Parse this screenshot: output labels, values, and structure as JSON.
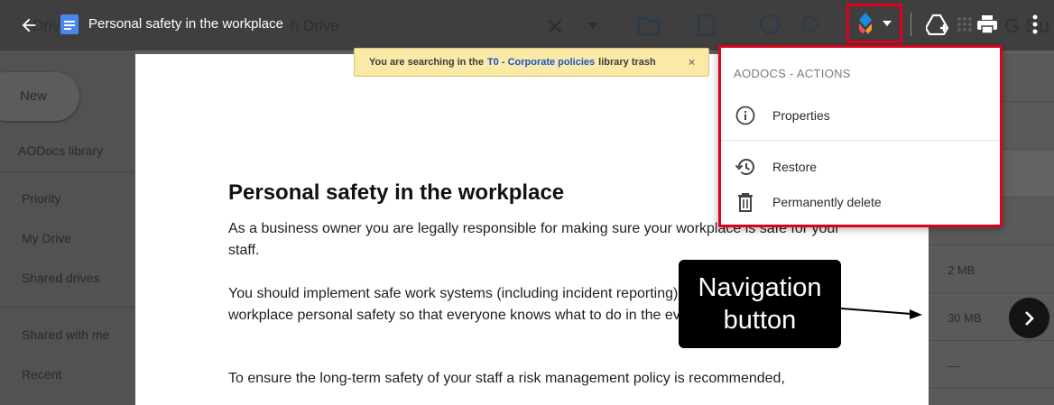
{
  "window": {
    "title": "Personal safety in the workplace"
  },
  "background": {
    "ghost_search_text": "h Drive",
    "ghost_brand_text": "G Su",
    "ghost_drive_text": "Drive",
    "new_button": "New",
    "sidebar": {
      "library": "AODocs library",
      "items": [
        "Priority",
        "My Drive",
        "Shared drives",
        "Shared with me",
        "Recent"
      ]
    },
    "file_sizes": [
      "2 MB",
      "30 MB",
      "—"
    ]
  },
  "banner": {
    "prefix": "You are searching in the",
    "library_link": "T0 - Corporate policies",
    "suffix": "library trash",
    "close": "×"
  },
  "document": {
    "heading": "Personal safety in the workplace",
    "paragraphs": [
      "As a business owner you are legally responsible for making sure your workplace is safe for your staff.",
      "You should implement safe work systems (including incident reporting) and train your staff in workplace personal safety so that everyone knows what to do in the event of an accident.",
      "To ensure the long-term safety of your staff a risk management policy is recommended,"
    ]
  },
  "menu": {
    "header": "AODOCS - ACTIONS",
    "items": [
      {
        "label": "Properties",
        "icon": "info-icon"
      },
      {
        "label": "Restore",
        "icon": "restore-icon"
      },
      {
        "label": "Permanently delete",
        "icon": "trash-icon"
      }
    ]
  },
  "callout": {
    "line1": "Navigation",
    "line2": "button"
  },
  "colors": {
    "highlight_red": "#e0001b",
    "banner_bg": "#fbe9a8",
    "link_blue": "#1a57c6"
  }
}
